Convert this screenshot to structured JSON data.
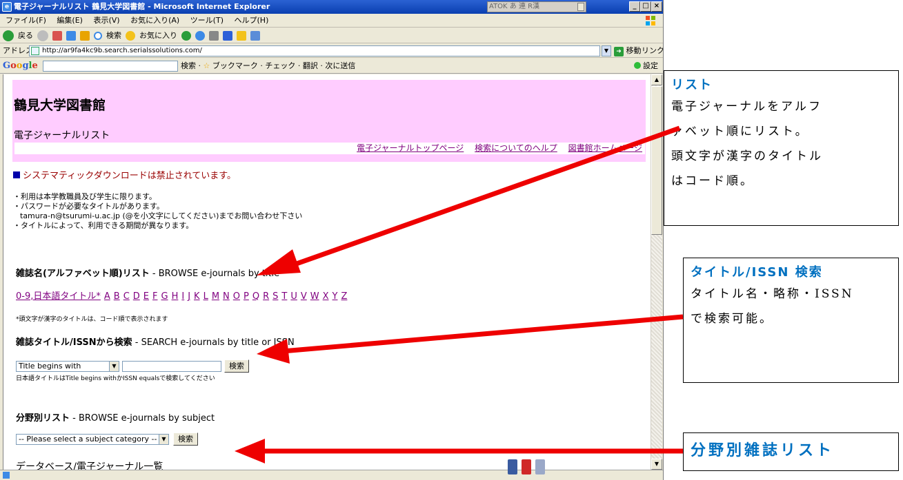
{
  "window": {
    "title": "電子ジャーナルリスト 鶴見大学図書館 - Microsoft Internet Explorer",
    "ime": "ATOK あ 連 R漢",
    "min": "_",
    "max": "□",
    "close": "×"
  },
  "menu": [
    "ファイル(F)",
    "編集(E)",
    "表示(V)",
    "お気に入り(A)",
    "ツール(T)",
    "ヘルプ(H)"
  ],
  "toolbar": {
    "back": "戻る",
    "search": "検索",
    "favorites": "お気に入り"
  },
  "address": {
    "label": "アドレス(D)",
    "url": "http://ar9fa4kc9b.search.serialssolutions.com/",
    "go": "移動",
    "links": "リンク"
  },
  "googlebar": {
    "search": "検索",
    "bookmark": "ブックマーク",
    "check": "チェック",
    "translate": "翻訳",
    "send": "次に送信",
    "settings": "設定"
  },
  "page": {
    "library": "鶴見大学図書館",
    "subtitle": "電子ジャーナルリスト",
    "nav": [
      "電子ジャーナルトップページ",
      "検索についてのヘルプ",
      "図書館ホームページ"
    ],
    "warning": "システマティックダウンロードは禁止されています。",
    "notes": [
      "・利用は本学教職員及び学生に限ります。",
      "・パスワードが必要なタイトルがあります。",
      "tamura-n@tsurumi-u.ac.jp (@を小文字にしてください)までお問い合わせ下さい",
      "・タイトルによって、利用できる期間が異なります。"
    ],
    "browse_title": {
      "jp": "雑誌名(アルファベット順)リスト",
      "en": " - BROWSE e-journals by title"
    },
    "alpha": [
      "0-9,日本語タイトル*",
      "A",
      "B",
      "C",
      "D",
      "E",
      "F",
      "G",
      "H",
      "I",
      "J",
      "K",
      "L",
      "M",
      "N",
      "O",
      "P",
      "Q",
      "R",
      "S",
      "T",
      "U",
      "V",
      "W",
      "X",
      "Y",
      "Z"
    ],
    "alpha_note": "*頭文字が漢字のタイトルは、コード順で表示されます",
    "search_title": {
      "jp": "雑誌タイトル/ISSNから検索",
      "en": " - SEARCH e-journals by title or ISSN"
    },
    "search_select": "Title begins with",
    "search_value": "",
    "search_button": "検索",
    "search_note": "日本語タイトルはTitle begins withかISSN equalsで検索してください",
    "subject_title": {
      "jp": "分野別リスト",
      "en": " - BROWSE e-journals by subject"
    },
    "subject_select": "-- Please select a subject category --",
    "subject_button": "検索",
    "db_title": "データベース/電子ジャーナル一覧"
  },
  "callouts": [
    {
      "title": "リスト",
      "lines": [
        "電子ジャーナルをアルフ",
        "ァベット順にリスト。",
        "頭文字が漢字のタイトル",
        "はコード順。"
      ]
    },
    {
      "title": "タイトル/ISSN 検索",
      "lines": [
        "タイトル名・略称・ISSN",
        "で検索可能。"
      ]
    },
    {
      "title": "分野別雑誌リスト",
      "lines": []
    }
  ],
  "colors": {
    "header_bg": "#ffccff",
    "link": "#800080",
    "warning": "#990000",
    "callout_title": "#0070c0",
    "arrow": "#ee0000"
  }
}
